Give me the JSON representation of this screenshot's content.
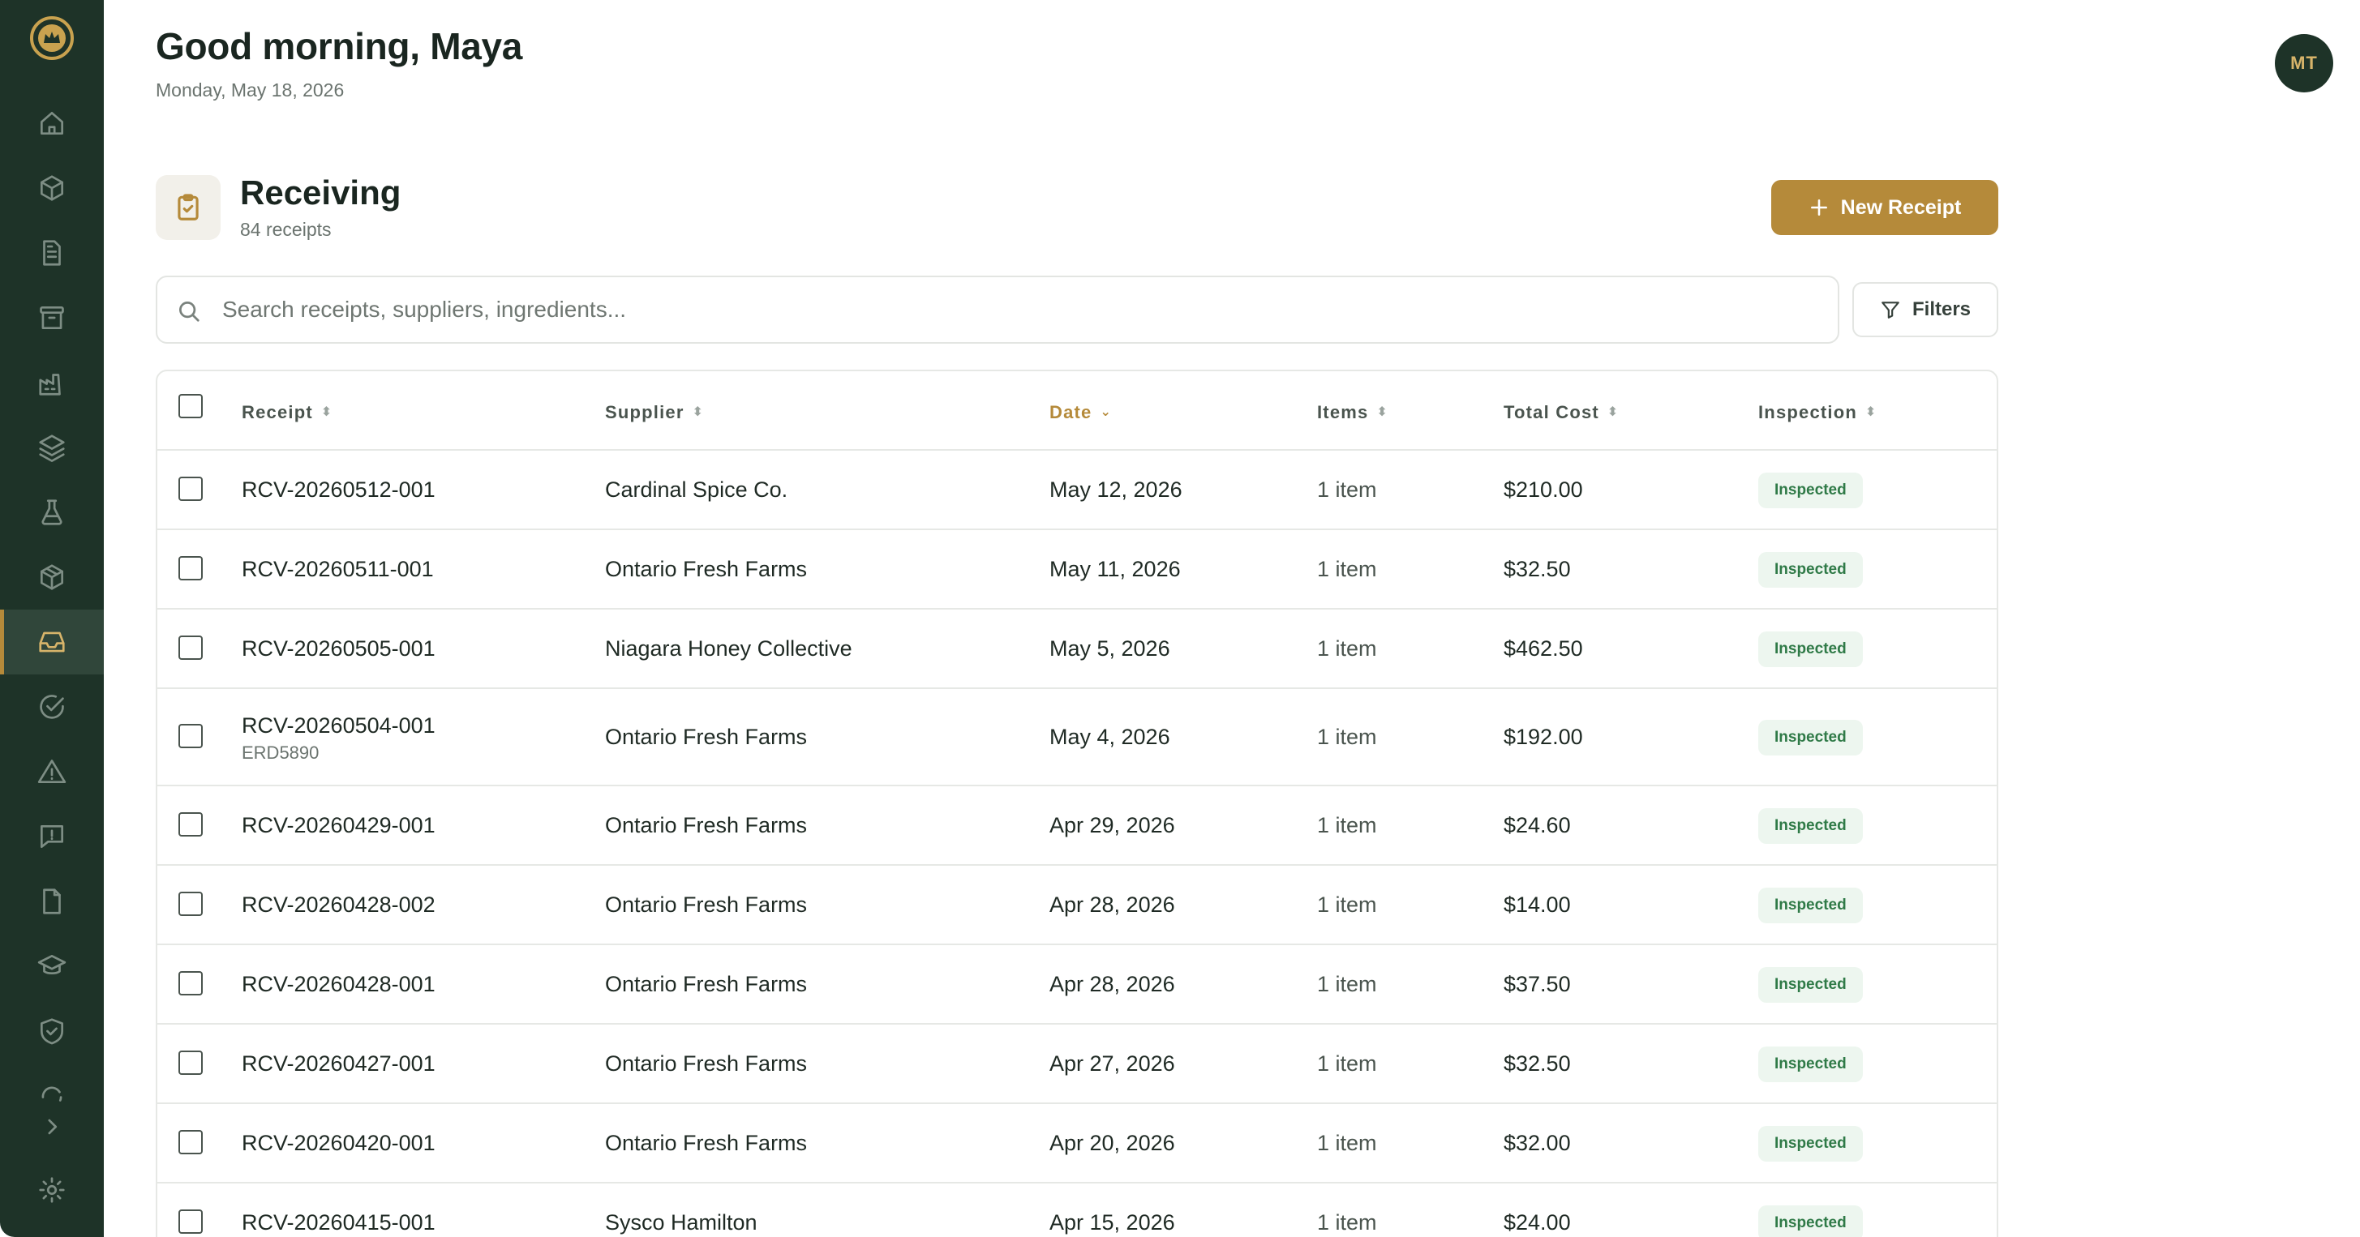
{
  "header": {
    "greeting": "Good morning, Maya",
    "date": "Monday, May 18, 2026",
    "avatar_initials": "MT"
  },
  "sidebar": {
    "active_index": 8,
    "icons": [
      "home-icon",
      "box-icon",
      "document-icon",
      "archive-icon",
      "factory-icon",
      "layers-icon",
      "flask-icon",
      "package-icon",
      "inbox-icon",
      "check-circle-icon",
      "warning-icon",
      "message-alert-icon",
      "file-icon",
      "graduation-cap-icon",
      "shield-check-icon",
      "refresh-icon",
      "chevron-right-icon",
      "gear-icon"
    ]
  },
  "section": {
    "title": "Receiving",
    "count": "84 receipts",
    "new_button": "New Receipt"
  },
  "search": {
    "placeholder": "Search receipts, suppliers, ingredients...",
    "filters_label": "Filters"
  },
  "table": {
    "columns": [
      "Receipt",
      "Supplier",
      "Date",
      "Items",
      "Total Cost",
      "Inspection"
    ],
    "sorted_column": "Date",
    "rows": [
      {
        "receipt": "RCV-20260512-001",
        "ref": "",
        "supplier": "Cardinal Spice Co.",
        "date": "May 12, 2026",
        "items": "1 item",
        "total": "$210.00",
        "inspection": "Inspected"
      },
      {
        "receipt": "RCV-20260511-001",
        "ref": "",
        "supplier": "Ontario Fresh Farms",
        "date": "May 11, 2026",
        "items": "1 item",
        "total": "$32.50",
        "inspection": "Inspected"
      },
      {
        "receipt": "RCV-20260505-001",
        "ref": "",
        "supplier": "Niagara Honey Collective",
        "date": "May 5, 2026",
        "items": "1 item",
        "total": "$462.50",
        "inspection": "Inspected"
      },
      {
        "receipt": "RCV-20260504-001",
        "ref": "ERD5890",
        "supplier": "Ontario Fresh Farms",
        "date": "May 4, 2026",
        "items": "1 item",
        "total": "$192.00",
        "inspection": "Inspected"
      },
      {
        "receipt": "RCV-20260429-001",
        "ref": "",
        "supplier": "Ontario Fresh Farms",
        "date": "Apr 29, 2026",
        "items": "1 item",
        "total": "$24.60",
        "inspection": "Inspected"
      },
      {
        "receipt": "RCV-20260428-002",
        "ref": "",
        "supplier": "Ontario Fresh Farms",
        "date": "Apr 28, 2026",
        "items": "1 item",
        "total": "$14.00",
        "inspection": "Inspected"
      },
      {
        "receipt": "RCV-20260428-001",
        "ref": "",
        "supplier": "Ontario Fresh Farms",
        "date": "Apr 28, 2026",
        "items": "1 item",
        "total": "$37.50",
        "inspection": "Inspected"
      },
      {
        "receipt": "RCV-20260427-001",
        "ref": "",
        "supplier": "Ontario Fresh Farms",
        "date": "Apr 27, 2026",
        "items": "1 item",
        "total": "$32.50",
        "inspection": "Inspected"
      },
      {
        "receipt": "RCV-20260420-001",
        "ref": "",
        "supplier": "Ontario Fresh Farms",
        "date": "Apr 20, 2026",
        "items": "1 item",
        "total": "$32.00",
        "inspection": "Inspected"
      },
      {
        "receipt": "RCV-20260415-001",
        "ref": "",
        "supplier": "Sysco Hamilton",
        "date": "Apr 15, 2026",
        "items": "1 item",
        "total": "$24.00",
        "inspection": "Inspected"
      }
    ]
  },
  "colors": {
    "sidebar_bg": "#1e3328",
    "accent": "#b58a3a",
    "badge_text": "#2f7a47",
    "badge_bg": "#edf6ef"
  }
}
